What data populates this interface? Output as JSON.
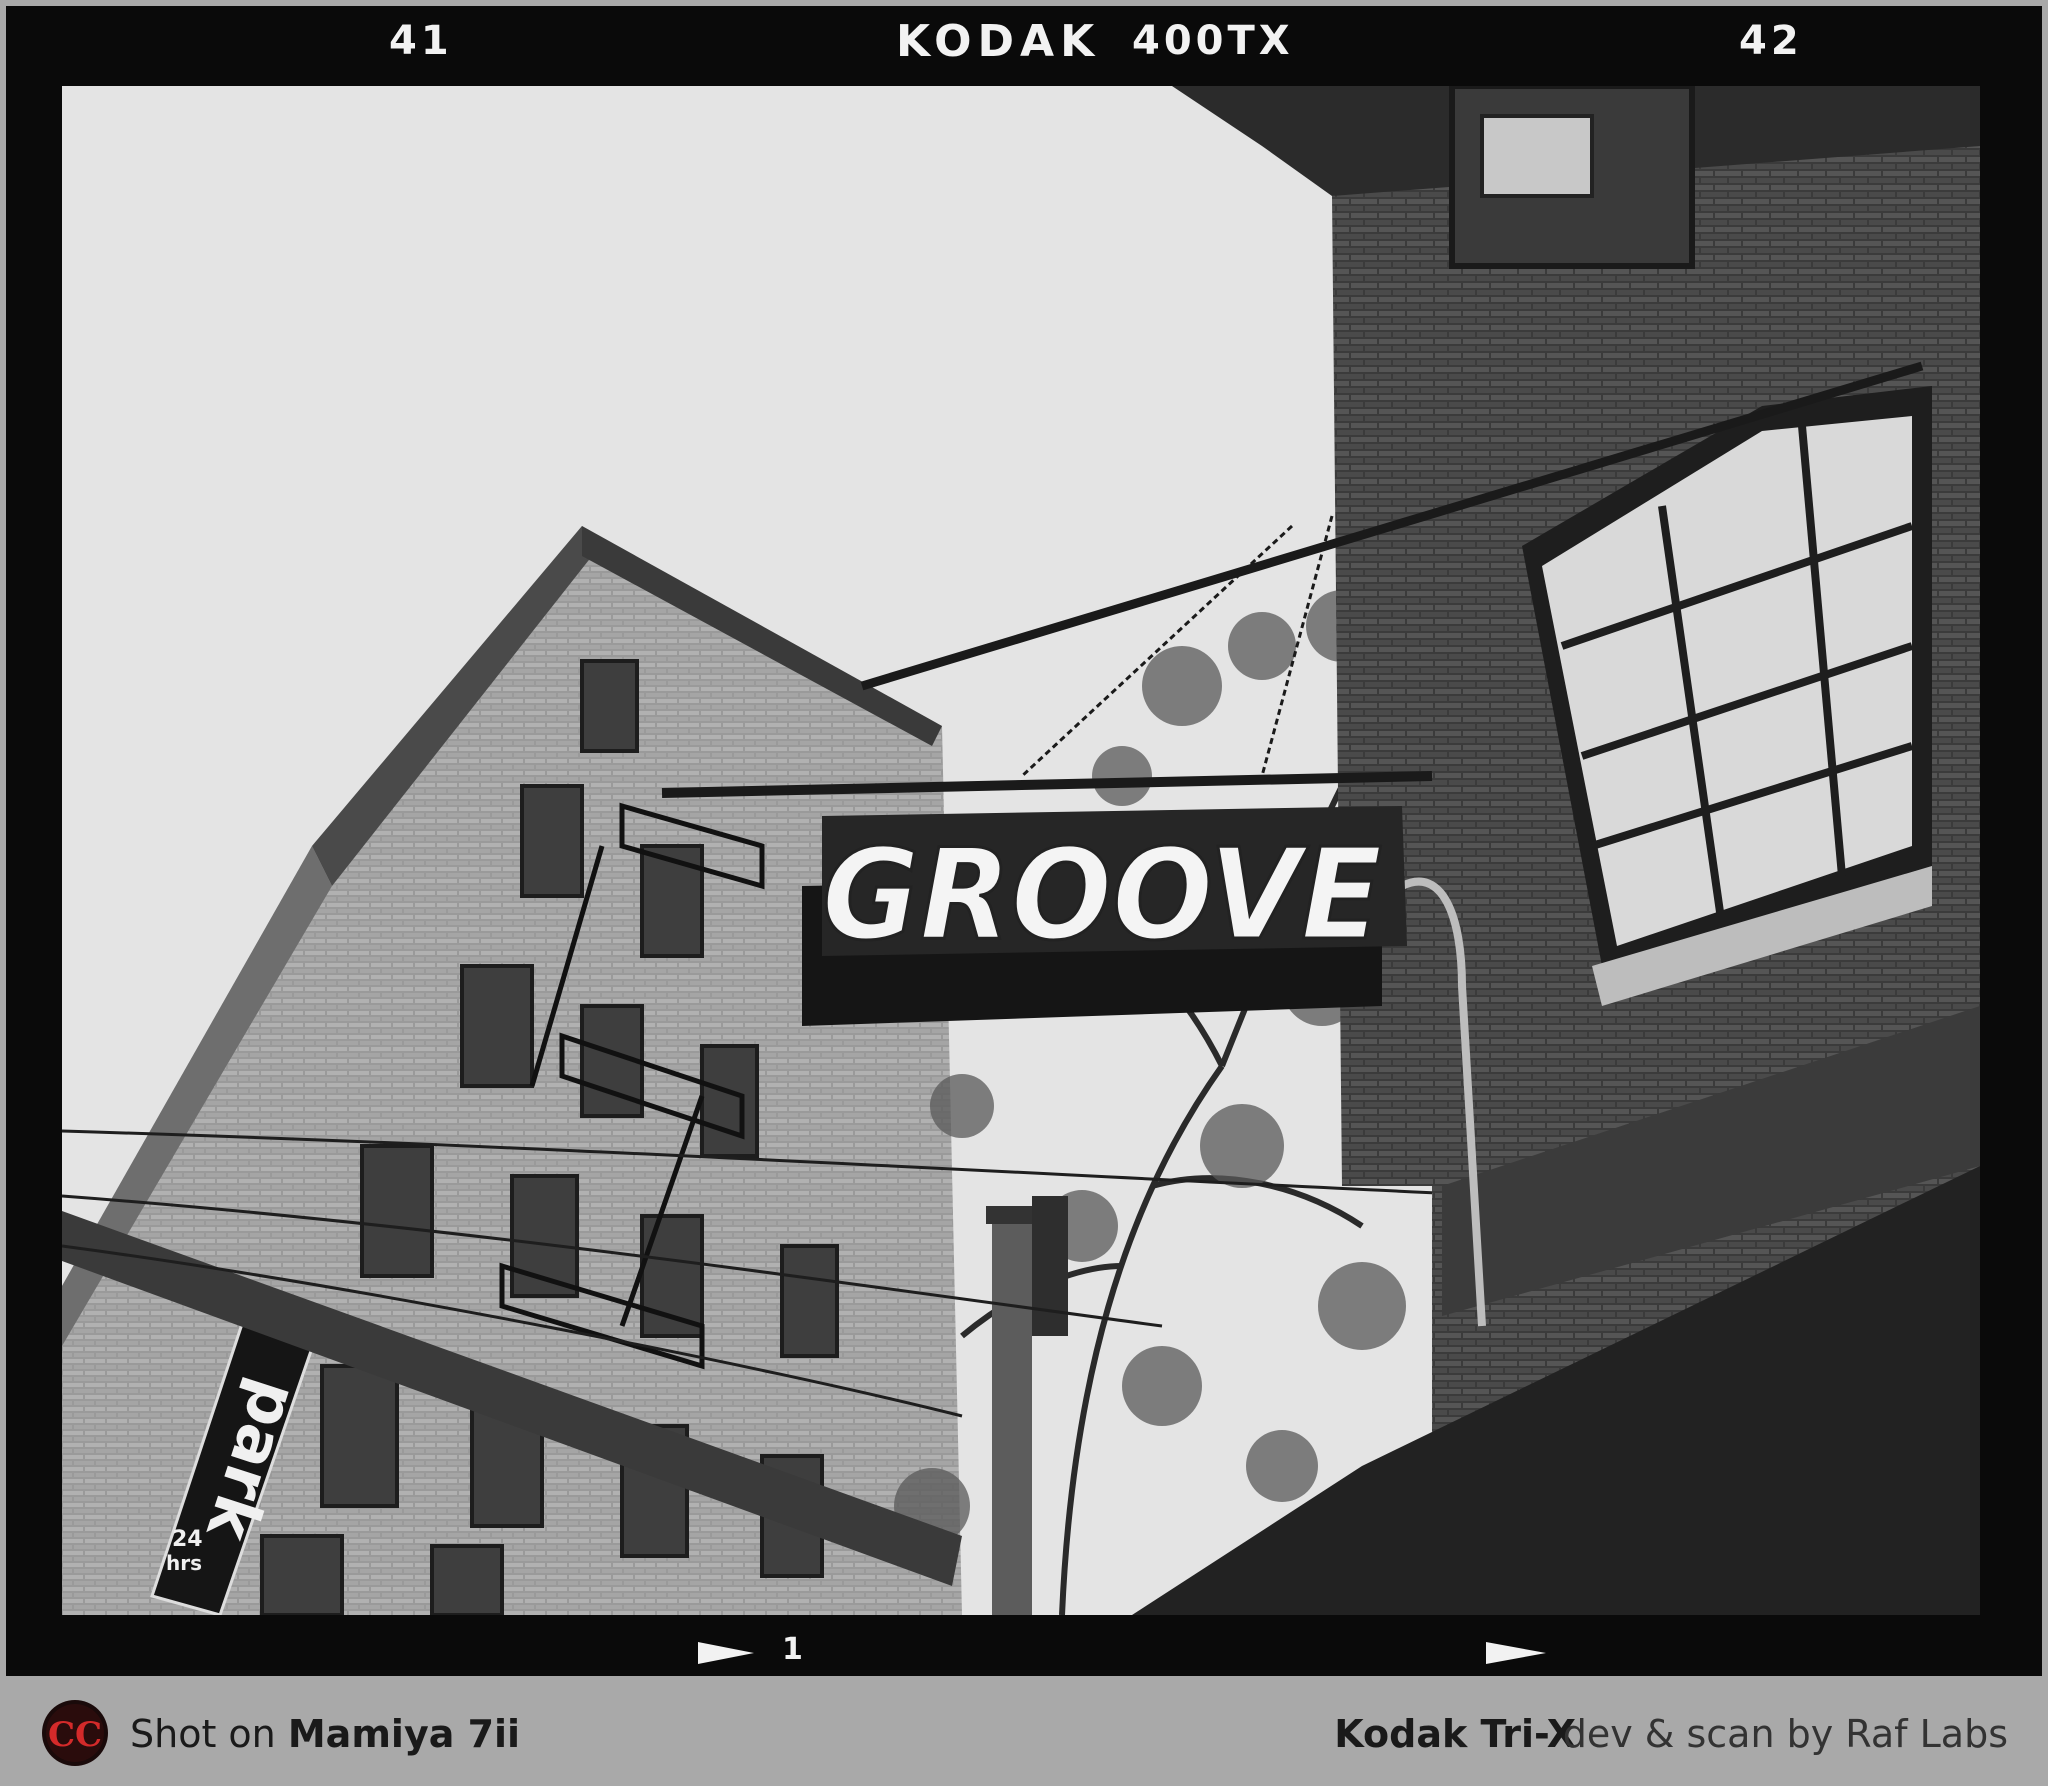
{
  "film_border": {
    "frame_number_left": "41",
    "brand": "KODAK",
    "stock": "400TX",
    "frame_number_right": "42",
    "frame_marker": "1"
  },
  "photo": {
    "sign_text": "GROOVE",
    "park_sign_text": "park",
    "park_sign_hours": "24",
    "park_sign_hours_unit": "hrs"
  },
  "footer": {
    "logo_letters": "CC",
    "shot_on_prefix": "Shot on",
    "camera": "Mamiya 7ii",
    "film": "Kodak Tri-X",
    "credit": "dev & scan by Raf Labs"
  }
}
